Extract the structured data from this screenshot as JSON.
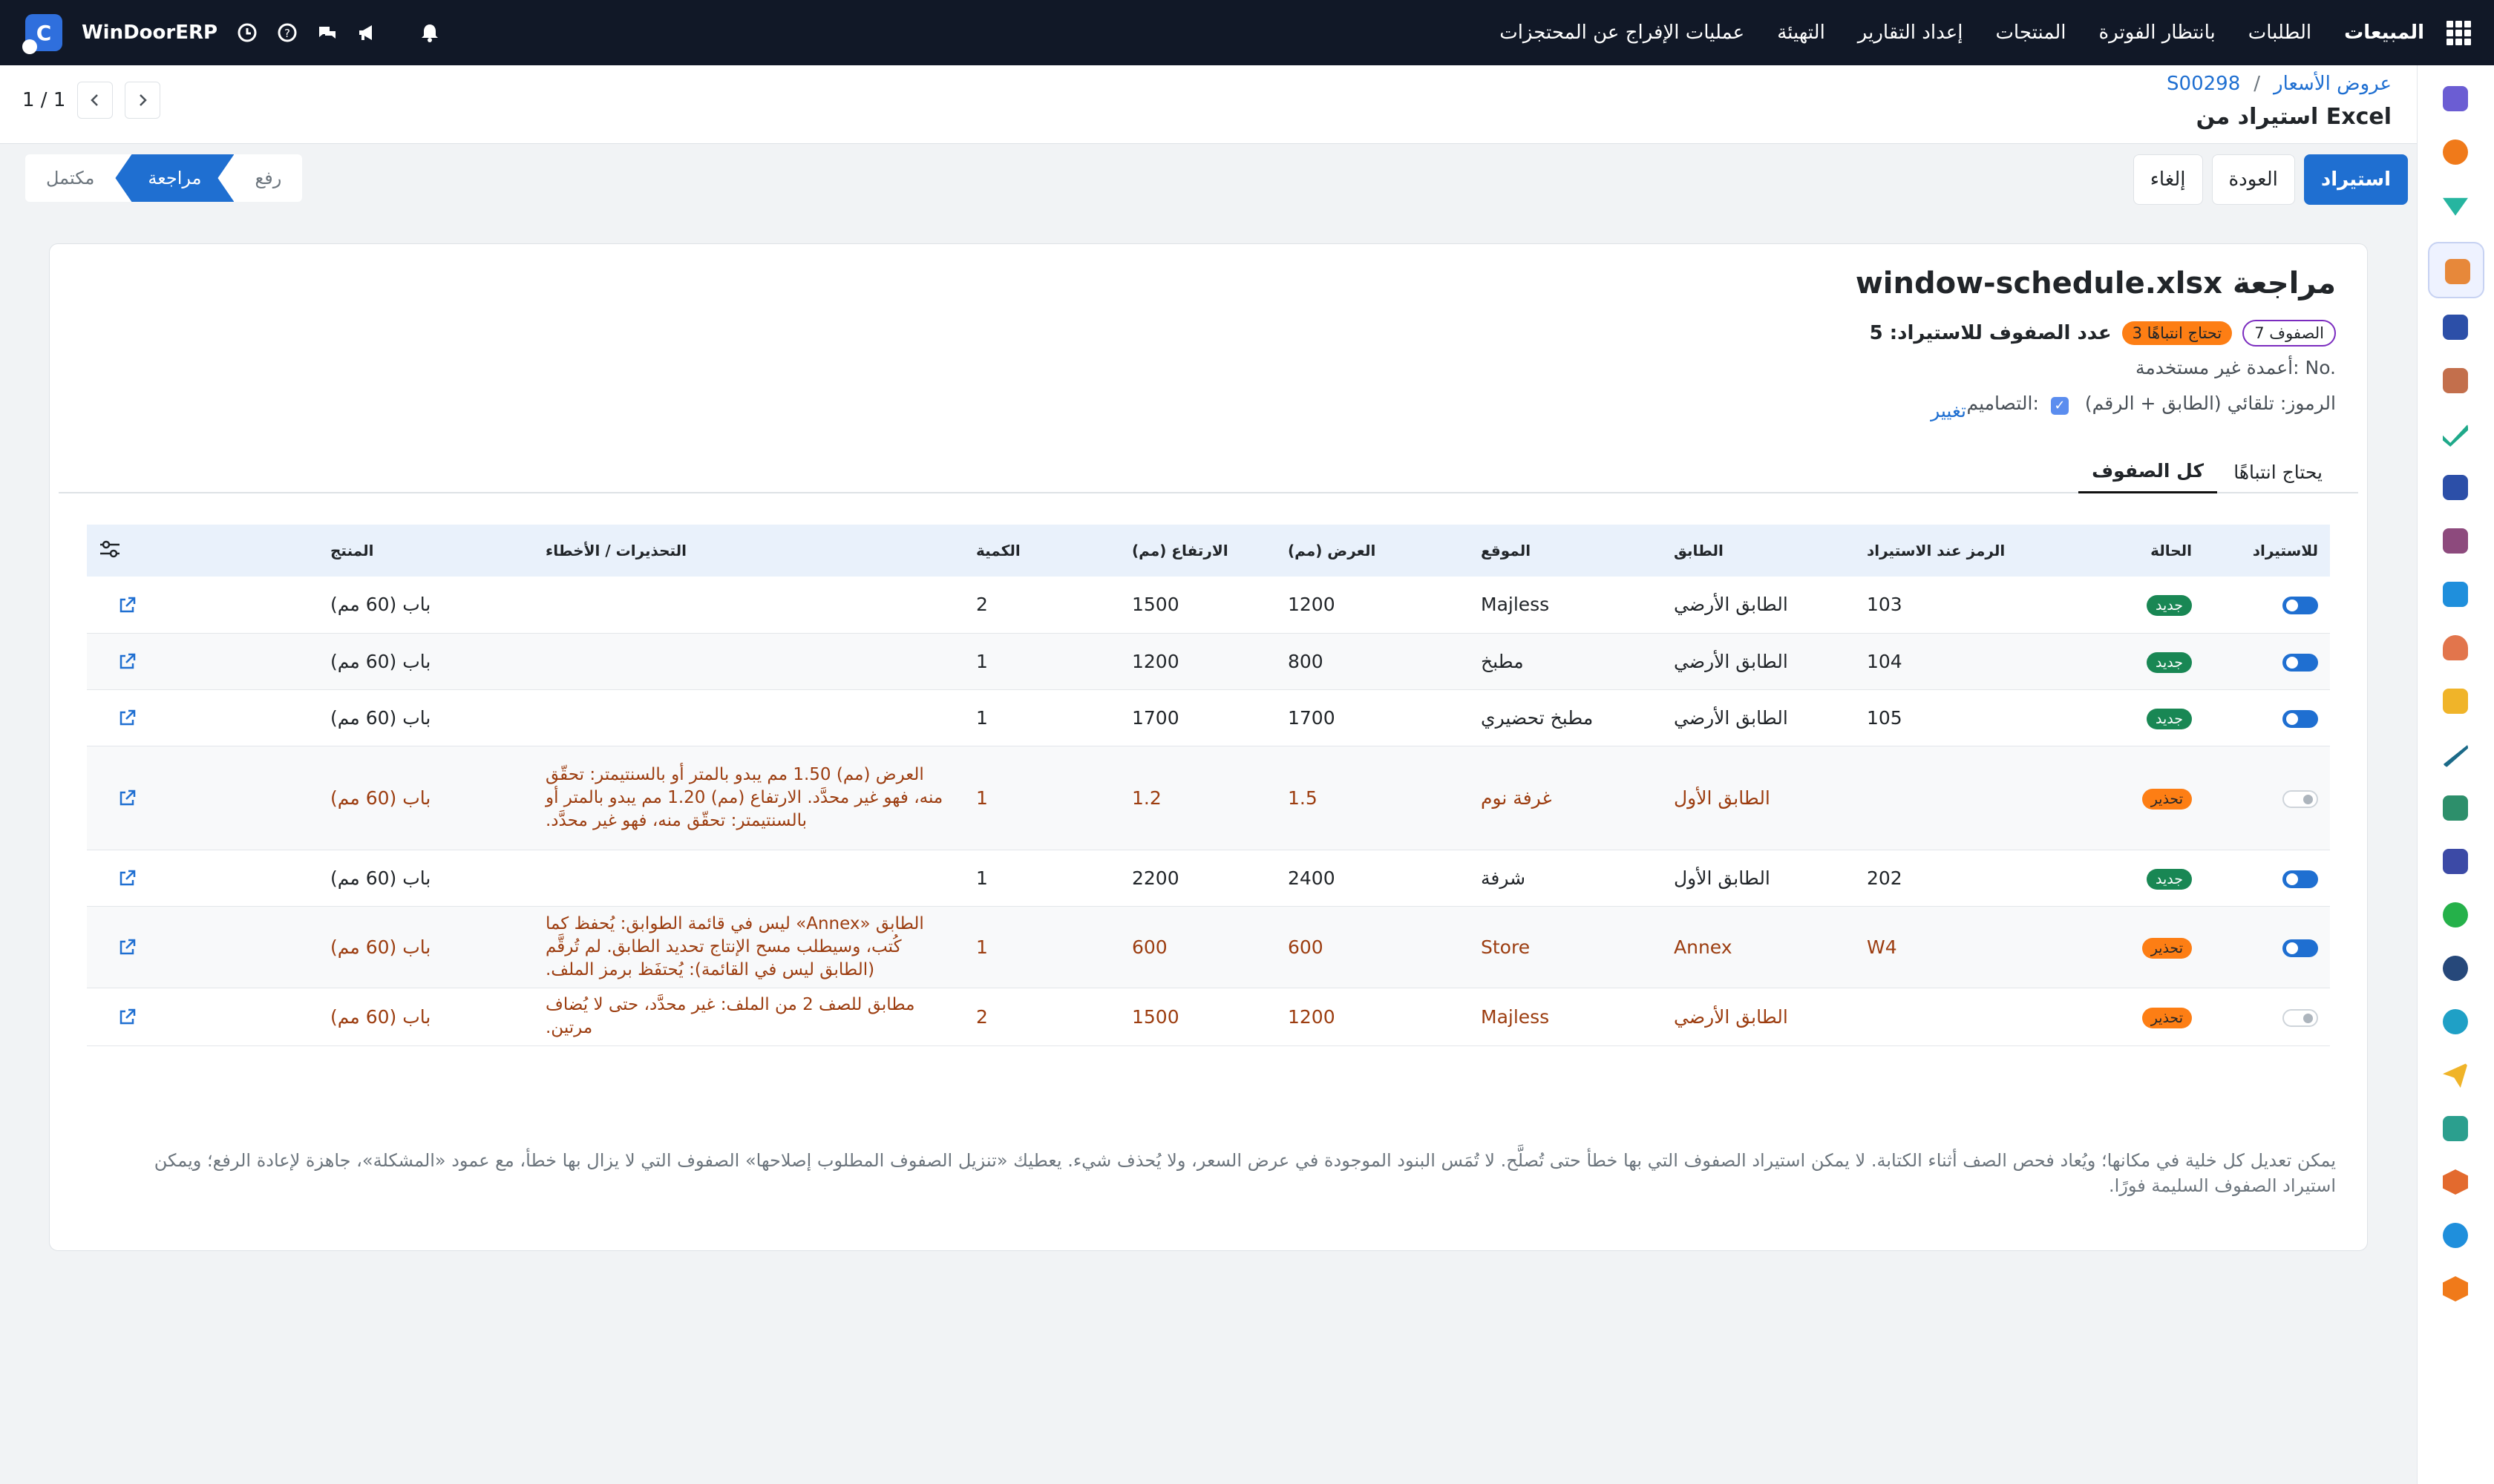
{
  "navbar": {
    "brand": "WinDoorERP",
    "menu": [
      "المبيعات",
      "الطلبات",
      "بانتظار الفوترة",
      "المنتجات",
      "إعداد التقارير",
      "التهيئة",
      "عمليات الإفراج عن المحتجزات"
    ]
  },
  "breadcrumb": {
    "parent": "عروض الأسعار",
    "separator": "/",
    "record": "S00298"
  },
  "page_title": "استيراد من Excel",
  "pager": {
    "value": "1 / 1"
  },
  "actions": {
    "import": "استيراد",
    "back": "العودة",
    "cancel": "إلغاء"
  },
  "steps": {
    "upload": "رفع",
    "review": "مراجعة",
    "done": "مكتمل"
  },
  "review": {
    "title": "مراجعة window-schedule.xlsx",
    "rows_pill": "الصفوف 7",
    "attention_pill": "تحتاج انتباهًا 3",
    "import_count": "عدد الصفوف للاستيراد: 5",
    "unused_columns": "أعمدة غير مستخدمة: No.",
    "codes": "الرموز: تلقائي (الطابق + الرقم)",
    "designs": "التصاميم:",
    "change": "تغيير"
  },
  "tabs": {
    "needs_attention": "يحتاج انتباهًا",
    "all_rows": "كل الصفوف"
  },
  "table": {
    "headers": {
      "import": "للاستيراد",
      "status": "الحالة",
      "code": "الرمز عند الاستيراد",
      "floor": "الطابق",
      "location": "الموقع",
      "width": "العرض (مم)",
      "height": "الارتفاع (مم)",
      "qty": "الكمية",
      "warnings": "التحذيرات / الأخطاء",
      "product": "المنتج"
    },
    "rows": [
      {
        "status": "جديد",
        "code": "103",
        "floor": "الطابق الأرضي",
        "location": "Majless",
        "width": "1200",
        "height": "1500",
        "qty": "2",
        "warnings": "",
        "product": "باب (60 مم)"
      },
      {
        "status": "جديد",
        "code": "104",
        "floor": "الطابق الأرضي",
        "location": "مطبخ",
        "width": "800",
        "height": "1200",
        "qty": "1",
        "warnings": "",
        "product": "باب (60 مم)"
      },
      {
        "status": "جديد",
        "code": "105",
        "floor": "الطابق الأرضي",
        "location": "مطبخ تحضيري",
        "width": "1700",
        "height": "1700",
        "qty": "1",
        "warnings": "",
        "product": "باب (60 مم)"
      },
      {
        "status": "تحذير",
        "code": "",
        "floor": "الطابق الأول",
        "location": "غرفة نوم",
        "width": "1.5",
        "height": "1.2",
        "qty": "1",
        "warnings": "العرض (مم) 1.50 مم يبدو بالمتر أو بالسنتيمتر: تحقّق منه، فهو غير محدَّد. الارتفاع (مم) 1.20 مم يبدو بالمتر أو بالسنتيمتر: تحقّق منه، فهو غير محدَّد.",
        "product": "باب (60 مم)"
      },
      {
        "status": "جديد",
        "code": "202",
        "floor": "الطابق الأول",
        "location": "شرفة",
        "width": "2400",
        "height": "2200",
        "qty": "1",
        "warnings": "",
        "product": "باب (60 مم)"
      },
      {
        "status": "تحذير",
        "code": "W4",
        "floor": "Annex",
        "location": "Store",
        "width": "600",
        "height": "600",
        "qty": "1",
        "warnings": "الطابق «Annex» ليس في قائمة الطوابق: يُحفظ كما كُتب، وسيطلب مسح الإنتاج تحديد الطابق. لم تُرقَّم (الطابق ليس في القائمة): يُحتفَظ برمز الملف.",
        "product": "باب (60 مم)"
      },
      {
        "status": "تحذير",
        "code": "",
        "floor": "الطابق الأرضي",
        "location": "Majless",
        "width": "1200",
        "height": "1500",
        "qty": "2",
        "warnings": "مطابق للصف 2 من الملف: غير محدَّد، حتى لا يُضاف مرتين.",
        "product": "باب (60 مم)"
      }
    ]
  },
  "footnote": "يمكن تعديل كل خلية في مكانها؛ ويُعاد فحص الصف أثناء الكتابة. لا يمكن استيراد الصفوف التي بها خطأ حتى تُصلَّح. لا تُمَس البنود الموجودة في عرض السعر، ولا يُحذف شيء. يعطيك «تنزيل الصفوف المطلوب إصلاحها» الصفوف التي لا يزال بها خطأ، مع عمود «المشكلة»، جاهزة لإعادة الرفع؛ ويمكن استيراد الصفوف السليمة فورًا.",
  "colors": {
    "accent": "#1f6fd1",
    "success": "#198754",
    "warning": "#fd7e14",
    "warning_text": "#9c3d10"
  }
}
